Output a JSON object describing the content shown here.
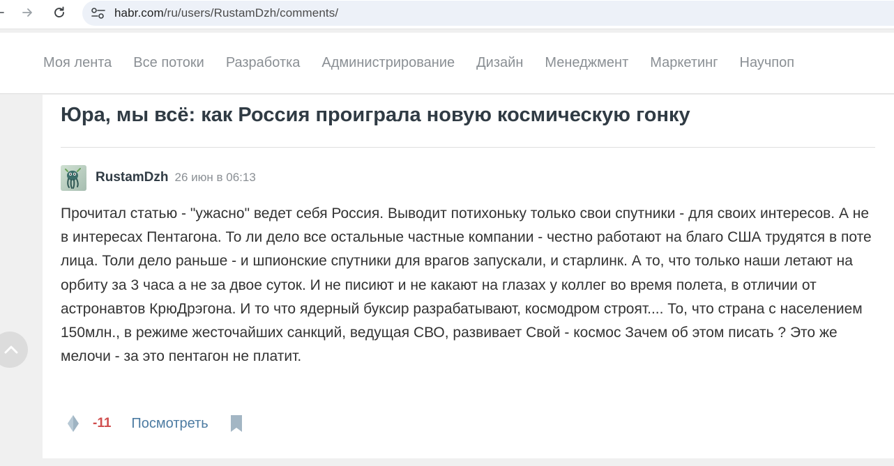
{
  "browser": {
    "url_host": "habr.com",
    "url_path": "/ru/users/RustamDzh/comments/"
  },
  "nav": {
    "items": [
      {
        "label": "Моя лента"
      },
      {
        "label": "Все потоки"
      },
      {
        "label": "Разработка"
      },
      {
        "label": "Администрирование"
      },
      {
        "label": "Дизайн"
      },
      {
        "label": "Менеджмент"
      },
      {
        "label": "Маркетинг"
      },
      {
        "label": "Научпоп"
      }
    ]
  },
  "article": {
    "title": "Юра, мы всё: как Россия проиграла новую космическую гонку"
  },
  "comment": {
    "author": "RustamDzh",
    "date": "26 июн в 06:13",
    "text": "Прочитал статью - \"ужасно\" ведет себя Россия. Выводит потихоньку только свои спутники - для своих интересов. А не в интересах Пентагона. То ли дело все остальные частные компании - честно работают на благо США трудятся в поте лица. Толи дело раньше - и шпионские спутники для врагов запускали, и старлинк. А то, что только наши летают на орбиту за 3 часа а не за двое суток. И не писиют и не какают на глазах у коллег во время полета, в отличии от астронавтов КрюДрэгона. И то что ядерный буксир разрабатывают, космодром строят.... То, что страна с населением 150млн., в режиме жесточайших санкций, ведущая СВО, развивает Свой - космос Зачем об этом писать ? Это же мелочи - за это пентагон не платит.",
    "score": "-11",
    "view_label": "Посмотреть"
  },
  "colors": {
    "score_negative": "#d04e4e",
    "link": "#4c7ba2",
    "nav_text": "#8a8f94",
    "title_text": "#303b44"
  },
  "icons": {
    "back": "arrow-left-icon",
    "forward": "arrow-right-icon",
    "reload": "reload-icon",
    "site_info": "tune-icon",
    "vote": "vote-diamond-icon",
    "bookmark": "bookmark-icon",
    "scroll_top": "chevron-up-icon"
  }
}
